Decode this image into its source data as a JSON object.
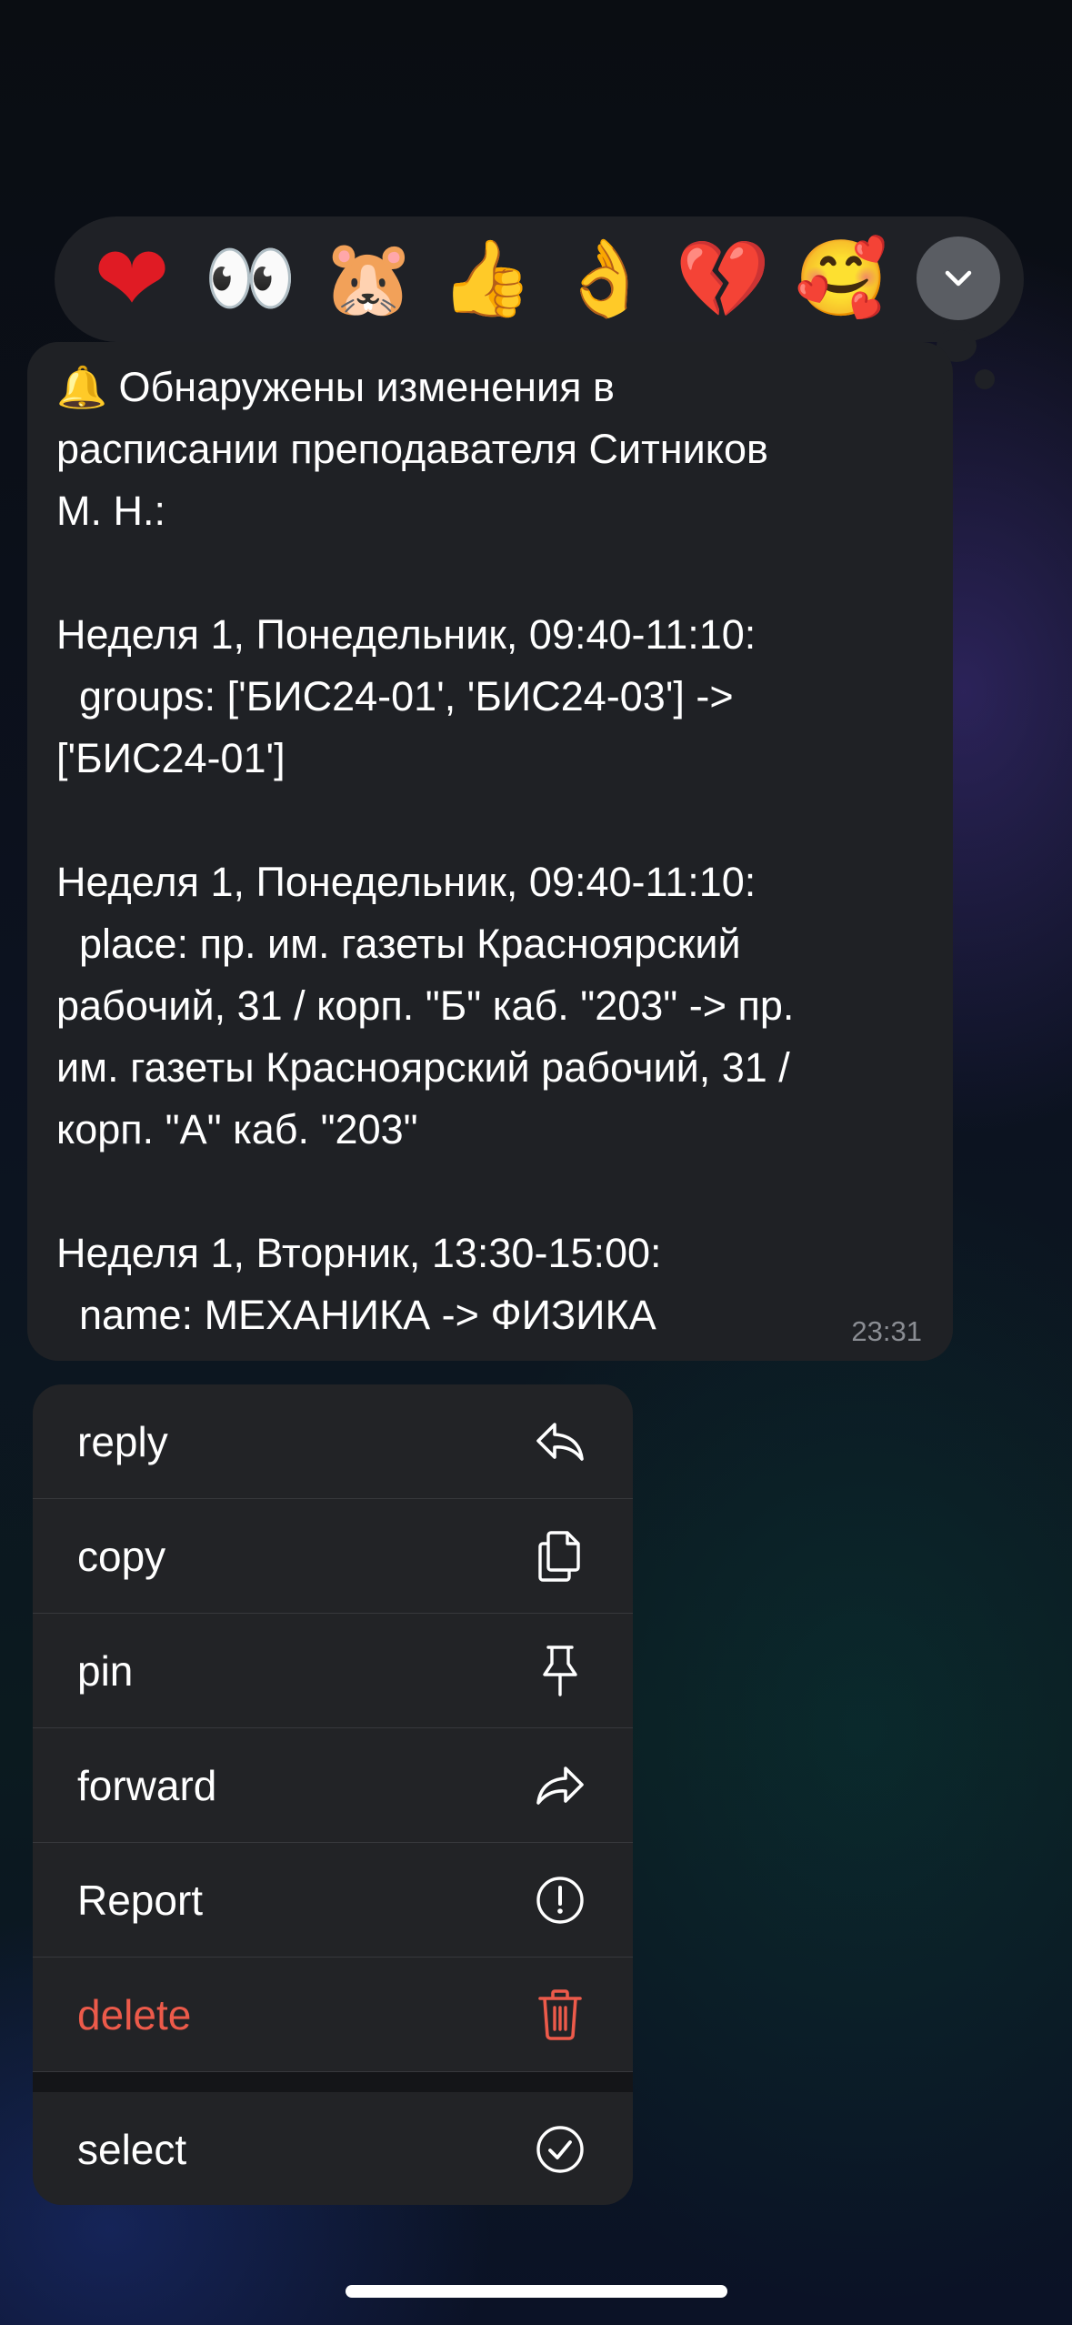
{
  "reactions": {
    "items": [
      {
        "name": "heart",
        "glyph": "❤"
      },
      {
        "name": "eyes",
        "glyph": "👀"
      },
      {
        "name": "crying-hamster",
        "glyph": "🐹"
      },
      {
        "name": "thumbs-up",
        "glyph": "👍"
      },
      {
        "name": "ok-hand",
        "glyph": "👌"
      },
      {
        "name": "broken-heart",
        "glyph": "💔"
      },
      {
        "name": "smiling-face-with-hearts",
        "glyph": "🥰"
      }
    ],
    "more_icon": "chevron-down-icon"
  },
  "message": {
    "lines": [
      "🔔 Обнаружены изменения в",
      "расписании преподавателя Ситников",
      "М. Н.:",
      "",
      "Неделя 1, Понедельник, 09:40-11:10:",
      "  groups: ['БИС24-01', 'БИС24-03'] ->",
      "['БИС24-01']",
      "",
      "Неделя 1, Понедельник, 09:40-11:10:",
      "  place: пр. им. газеты Красноярский",
      "рабочий, 31 / корп. \"Б\" каб. \"203\" -> пр.",
      "им. газеты Красноярский рабочий, 31 /",
      "корп. \"А\" каб. \"203\"",
      "",
      "Неделя 1, Вторник, 13:30-15:00:",
      "  name: МЕХАНИКА -> ФИЗИКА"
    ],
    "time": "23:31"
  },
  "menu": {
    "items": [
      {
        "label": "reply",
        "icon": "reply-icon"
      },
      {
        "label": "copy",
        "icon": "copy-icon"
      },
      {
        "label": "pin",
        "icon": "pin-icon"
      },
      {
        "label": "forward",
        "icon": "forward-icon"
      },
      {
        "label": "Report",
        "icon": "report-icon"
      },
      {
        "label": "delete",
        "icon": "trash-icon"
      },
      {
        "label": "select",
        "icon": "select-check-icon"
      }
    ]
  },
  "colors": {
    "danger": "#ec5a4a",
    "bubble": "#1f2125",
    "menu": "#222326"
  }
}
